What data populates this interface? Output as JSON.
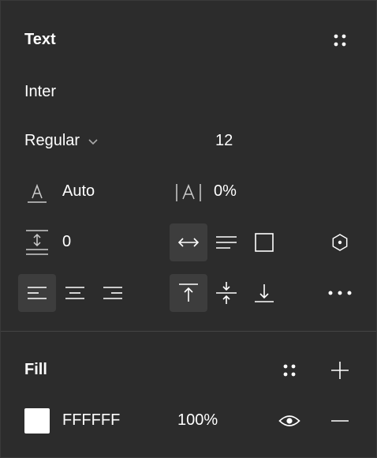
{
  "text_section": {
    "title": "Text",
    "font_family": "Inter",
    "font_weight": "Regular",
    "font_size": "12",
    "line_height": "Auto",
    "letter_spacing": "0%",
    "paragraph_spacing": "0"
  },
  "fill_section": {
    "title": "Fill",
    "color_hex": "FFFFFF",
    "opacity": "100%",
    "swatch_color": "#ffffff"
  },
  "colors": {
    "background": "#2c2c2c",
    "active": "#3d3d3d",
    "divider": "#444444"
  }
}
